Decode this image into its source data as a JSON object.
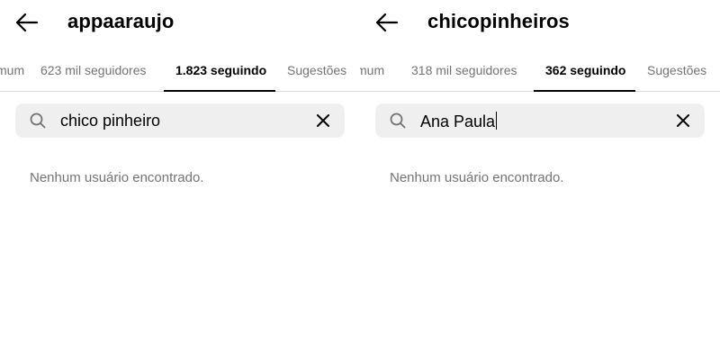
{
  "panels": [
    {
      "username": "appaaraujo",
      "tabs": [
        {
          "label": "mum",
          "active": false
        },
        {
          "label": "623 mil seguidores",
          "active": false
        },
        {
          "label": "1.823 seguindo",
          "active": true
        },
        {
          "label": "Sugestões",
          "active": false
        }
      ],
      "search": {
        "value": "chico pinheiro",
        "has_caret": false
      },
      "empty_message": "Nenhum usuário encontrado.",
      "icons": {
        "back": "arrow-left-icon",
        "search": "search-icon",
        "clear": "close-icon"
      }
    },
    {
      "username": "chicopinheiros",
      "tabs": [
        {
          "label": "mum",
          "active": false
        },
        {
          "label": "318 mil seguidores",
          "active": false
        },
        {
          "label": "362 seguindo",
          "active": true
        },
        {
          "label": "Sugestões",
          "active": false
        }
      ],
      "search": {
        "value": "Ana Paula",
        "has_caret": true
      },
      "empty_message": "Nenhum usuário encontrado.",
      "icons": {
        "back": "arrow-left-icon",
        "search": "search-icon",
        "clear": "close-icon"
      }
    }
  ],
  "colors": {
    "text_primary": "#000000",
    "text_secondary": "#737373",
    "search_bg": "#efefef",
    "divider": "#dbdbdb"
  }
}
